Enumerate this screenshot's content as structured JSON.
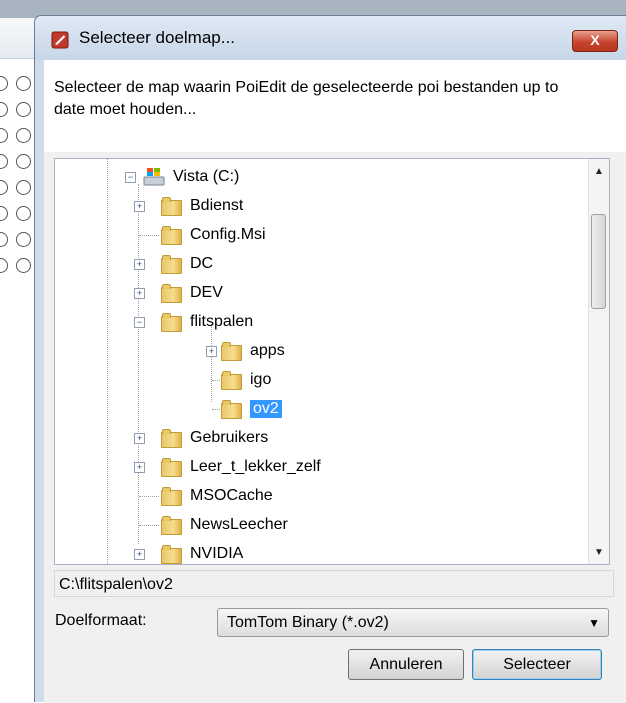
{
  "dialog": {
    "title": "Selecteer doelmap...",
    "close_label": "X",
    "description": "Selecteer de map waarin PoiEdit de geselecteerde poi bestanden up to date moet houden...",
    "tree": {
      "root": "Vista (C:)",
      "items": [
        {
          "label": "Bdienst",
          "expandable": true,
          "level": 1
        },
        {
          "label": "Config.Msi",
          "expandable": false,
          "level": 1
        },
        {
          "label": "DC",
          "expandable": true,
          "level": 1
        },
        {
          "label": "DEV",
          "expandable": true,
          "level": 1
        },
        {
          "label": "flitspalen",
          "expandable": true,
          "expanded": true,
          "level": 1
        },
        {
          "label": "apps",
          "expandable": true,
          "level": 2
        },
        {
          "label": "igo",
          "expandable": false,
          "level": 2
        },
        {
          "label": "ov2",
          "expandable": false,
          "level": 2,
          "selected": true
        },
        {
          "label": "Gebruikers",
          "expandable": true,
          "level": 1
        },
        {
          "label": "Leer_t_lekker_zelf",
          "expandable": true,
          "level": 1
        },
        {
          "label": "MSOCache",
          "expandable": false,
          "level": 1
        },
        {
          "label": "NewsLeecher",
          "expandable": false,
          "level": 1
        },
        {
          "label": "NVIDIA",
          "expandable": true,
          "level": 1
        }
      ]
    },
    "path": "C:\\flitspalen\\ov2",
    "format_label": "Doelformaat:",
    "format_value": "TomTom Binary (*.ov2)",
    "cancel_label": "Annuleren",
    "select_label": "Selecteer"
  },
  "icons": {
    "app_icon": "app-icon",
    "drive_icon": "drive-icon",
    "folder_icon": "folder-icon",
    "close_icon": "close-icon"
  },
  "colors": {
    "title_bar": "#cfdcea",
    "close_button": "#c7452f",
    "selection": "#3399ff"
  }
}
